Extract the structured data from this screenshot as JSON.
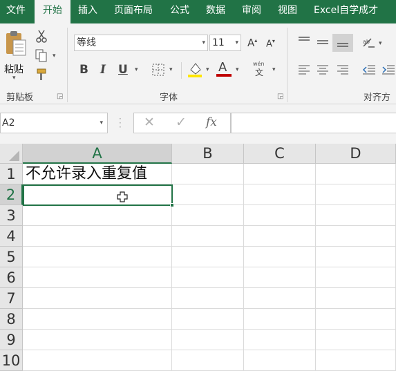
{
  "ribbon_tabs": [
    "文件",
    "开始",
    "插入",
    "页面布局",
    "公式",
    "数据",
    "审阅",
    "视图",
    "Excel自学成才"
  ],
  "active_tab": "开始",
  "clipboard": {
    "paste_label": "粘贴",
    "group_label": "剪贴板"
  },
  "font": {
    "name": "等线",
    "size": "11",
    "group_label": "字体",
    "bold": "B",
    "italic": "I",
    "underline": "U",
    "color_letter": "A",
    "phonetic_label": "wén"
  },
  "alignment": {
    "group_label": "对齐方式"
  },
  "formula_bar": {
    "name_box": "A2",
    "fx_label": "fx",
    "formula": ""
  },
  "columns": [
    "A",
    "B",
    "C",
    "D"
  ],
  "rows": [
    "1",
    "2",
    "3",
    "4",
    "5",
    "6",
    "7",
    "8",
    "9",
    "10"
  ],
  "cells": {
    "A1": "不允许录入重复值"
  },
  "selected_cell": "A2",
  "colors": {
    "accent": "#217346",
    "highlight_yellow": "#FFE600",
    "font_red": "#C00000"
  }
}
